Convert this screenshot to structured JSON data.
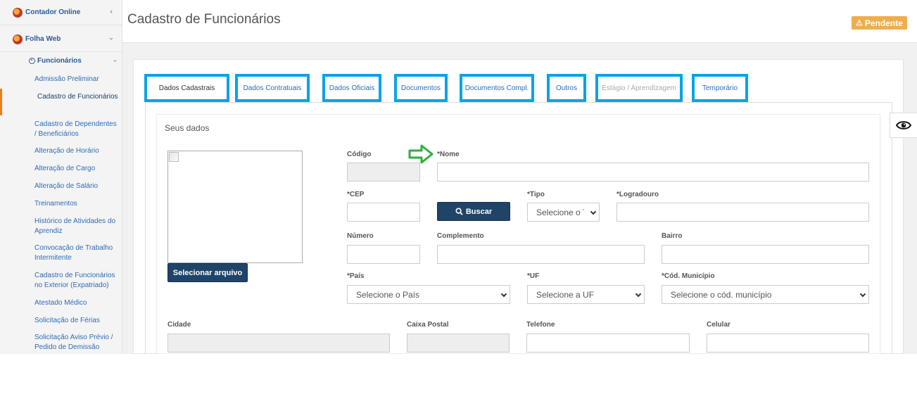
{
  "sidebar": {
    "contador_online": "Contador Online",
    "folha_web": "Folha Web",
    "funcionarios": "Funcionários",
    "items": [
      "Admissão Preliminar",
      "Cadastro de Funcionários",
      "Cadastro de Dependentes / Beneficiários",
      "Alteração de Horário",
      "Alteração de Cargo",
      "Alteração de Salário",
      "Treinamentos",
      "Histórico de Atividades do Aprendiz",
      "Convocação de Trabalho Intermitente",
      "Cadastro de Funcionários no Exterior (Expatriado)",
      "Atestado Médico",
      "Solicitação de Férias",
      "Solicitação Aviso Prévio / Pedido de Demissão"
    ],
    "active_item": "Cadastro de Funcionários",
    "accent_color": "#f07f1f"
  },
  "header": {
    "title": "Cadastro de Funcionários",
    "status": "Pendente",
    "status_color": "#f0ad4e"
  },
  "tabs": [
    "Dados Cadastrais",
    "Dados Contratuais",
    "Dados Oficiais",
    "Documentos",
    "Documentos Compl.",
    "Outros",
    "Estágio / Aprendizagem",
    "Temporário"
  ],
  "active_tab": "Dados Cadastrais",
  "highlight_color": "#0aa3e6",
  "form": {
    "section_title": "Seus dados",
    "select_file_button": "Selecionar arquivo",
    "codigo_label": "Código",
    "nome_label": "*Nome",
    "cep_label": "*CEP",
    "buscar_button": "Buscar",
    "tipo_label": "*Tipo",
    "tipo_value": "Selecione o Tipo",
    "logradouro_label": "*Logradouro",
    "numero_label": "Número",
    "complemento_label": "Complemento",
    "bairro_label": "Bairro",
    "pais_label": "*País",
    "pais_value": "Selecione o País",
    "uf_label": "*UF",
    "uf_value": "Selecione a UF",
    "municipio_label": "*Cód. Município",
    "municipio_value": "Selecione o cód. município",
    "cidade_label": "Cidade",
    "caixa_postal_label": "Caixa Postal",
    "telefone_label": "Telefone",
    "celular_label": "Celular"
  },
  "icons": {
    "pointer_arrow": "green-arrow-icon",
    "visibility": "eye-icon"
  }
}
